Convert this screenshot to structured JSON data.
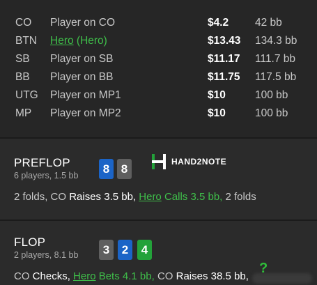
{
  "players": [
    {
      "pos": "CO",
      "name": "Player on CO",
      "hero": false,
      "stack": "$4.2",
      "bb": "42 bb"
    },
    {
      "pos": "BTN",
      "name": "Hero",
      "hero": true,
      "tag": " (Hero)",
      "stack": "$13.43",
      "bb": "134.3 bb"
    },
    {
      "pos": "SB",
      "name": "Player on SB",
      "hero": false,
      "stack": "$11.17",
      "bb": "111.7 bb"
    },
    {
      "pos": "BB",
      "name": "Player on BB",
      "hero": false,
      "stack": "$11.75",
      "bb": "117.5 bb"
    },
    {
      "pos": "UTG",
      "name": "Player on MP1",
      "hero": false,
      "stack": "$10",
      "bb": "100 bb"
    },
    {
      "pos": "MP",
      "name": "Player on MP2",
      "hero": false,
      "stack": "$10",
      "bb": "100 bb"
    }
  ],
  "preflop": {
    "title": "PREFLOP",
    "sub": "6 players, 1.5 bb",
    "cards": [
      {
        "rank": "8",
        "color": "blue"
      },
      {
        "rank": "8",
        "color": "gray"
      }
    ],
    "action": {
      "p1": "2 folds, CO ",
      "raises": "Raises 3.5 bb,",
      "p2": " ",
      "hero": "Hero",
      "calls": " Calls 3.5 bb,",
      "p3": " 2 folds"
    }
  },
  "flop": {
    "title": "FLOP",
    "sub": "2 players, 8.1 bb",
    "cards": [
      {
        "rank": "3",
        "color": "gray"
      },
      {
        "rank": "2",
        "color": "blue"
      },
      {
        "rank": "4",
        "color": "green"
      }
    ],
    "action": {
      "p1": "CO ",
      "checks": "Checks,",
      "p2": " ",
      "hero": "Hero",
      "bets": " Bets 4.1 bb,",
      "p3": " CO ",
      "raises": "Raises 38.5 bb,"
    }
  },
  "logo": {
    "text": "HAND2NOTE",
    "icon": "h2n-logo-icon"
  },
  "misc": {
    "qmark": "?"
  },
  "colors": {
    "hero_green": "#3fbf4a",
    "card_blue": "#1b64c7",
    "card_gray": "#5f5f5f",
    "card_green": "#23a23a"
  }
}
